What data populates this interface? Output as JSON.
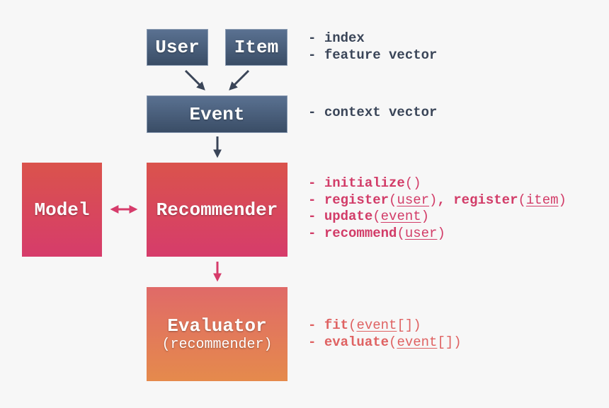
{
  "boxes": {
    "user": "User",
    "item": "Item",
    "event": "Event",
    "model": "Model",
    "recommender": "Recommender",
    "evaluator": "Evaluator",
    "evaluator_sub": "(recommender)"
  },
  "notes": {
    "user_item": [
      "index",
      "feature vector"
    ],
    "event": [
      "context vector"
    ],
    "recommender": [
      {
        "fn": "initialize",
        "args": []
      },
      {
        "fn": "register",
        "args": [
          "user"
        ],
        "fn2": "register",
        "args2": [
          "item"
        ]
      },
      {
        "fn": "update",
        "args": [
          "event"
        ]
      },
      {
        "fn": "recommend",
        "args": [
          "user"
        ]
      }
    ],
    "evaluator": [
      {
        "fn": "fit",
        "args": [
          "event"
        ],
        "suffix": "[]"
      },
      {
        "fn": "evaluate",
        "args": [
          "event"
        ],
        "suffix": "[]"
      }
    ]
  },
  "colors": {
    "blue_top": "#5a7191",
    "blue_bottom": "#3a4d66",
    "red_top": "#da534c",
    "red_bottom": "#d63c6b",
    "orange_top": "#e06a68",
    "orange_bottom": "#e58a4c",
    "dark_text": "#3a4558",
    "pink_text": "#d23c68",
    "coral_text": "#df6262"
  }
}
